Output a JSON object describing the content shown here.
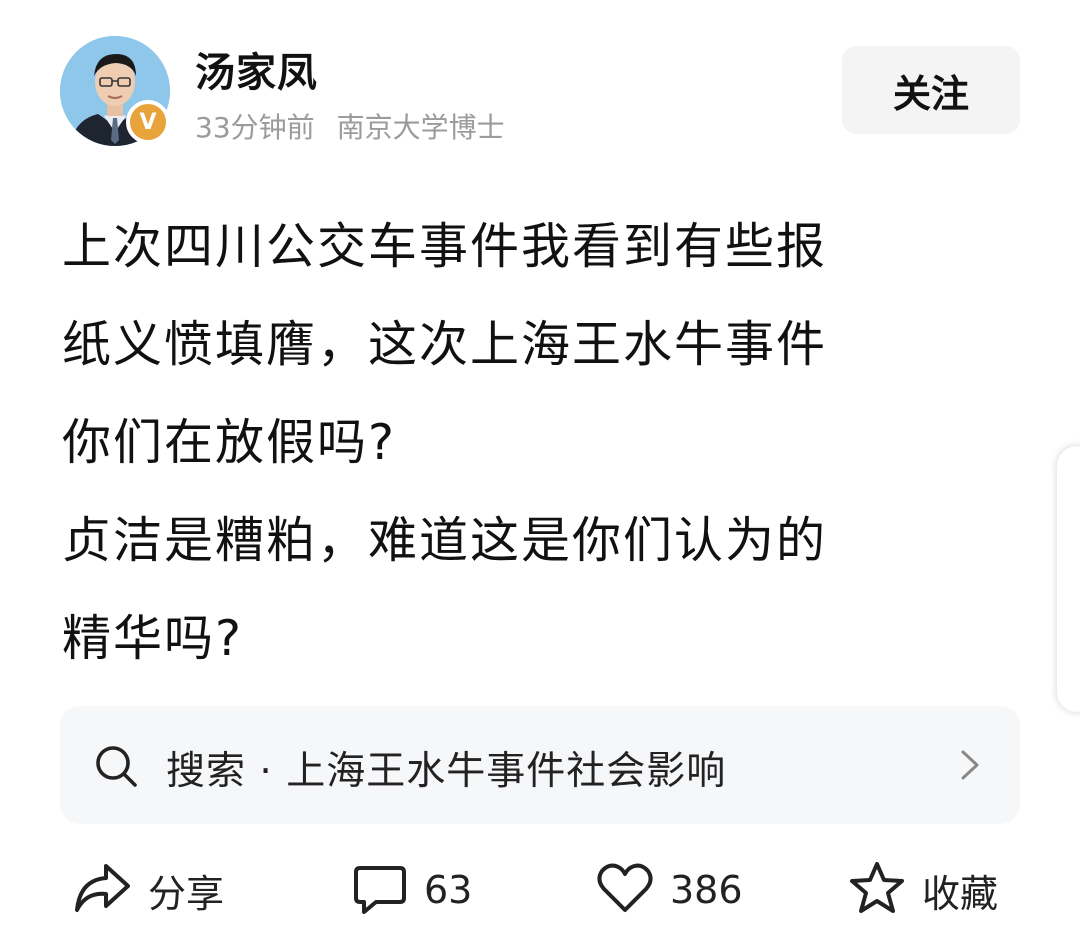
{
  "author": {
    "name": "汤家凤",
    "time_ago": "33分钟前",
    "title": "南京大学博士",
    "verified_badge": "V"
  },
  "follow_button": {
    "label": "关注"
  },
  "post": {
    "lines": [
      "上次四川公交车事件我看到有些报",
      "纸义愤填膺，这次上海王水牛事件",
      "你们在放假吗?",
      "贞洁是糟粕，难道这是你们认为的",
      "精华吗?"
    ]
  },
  "search": {
    "text": "搜索 · 上海王水牛事件社会影响",
    "icon": "search-icon"
  },
  "actions": {
    "share_label": "分享",
    "comment_count": "63",
    "like_count": "386",
    "favorite_label": "收藏"
  },
  "colors": {
    "badge": "#e8a33a",
    "meta_text": "#9b9b9b",
    "follow_bg": "#f4f4f4",
    "search_bg": "#f6f7f9"
  }
}
